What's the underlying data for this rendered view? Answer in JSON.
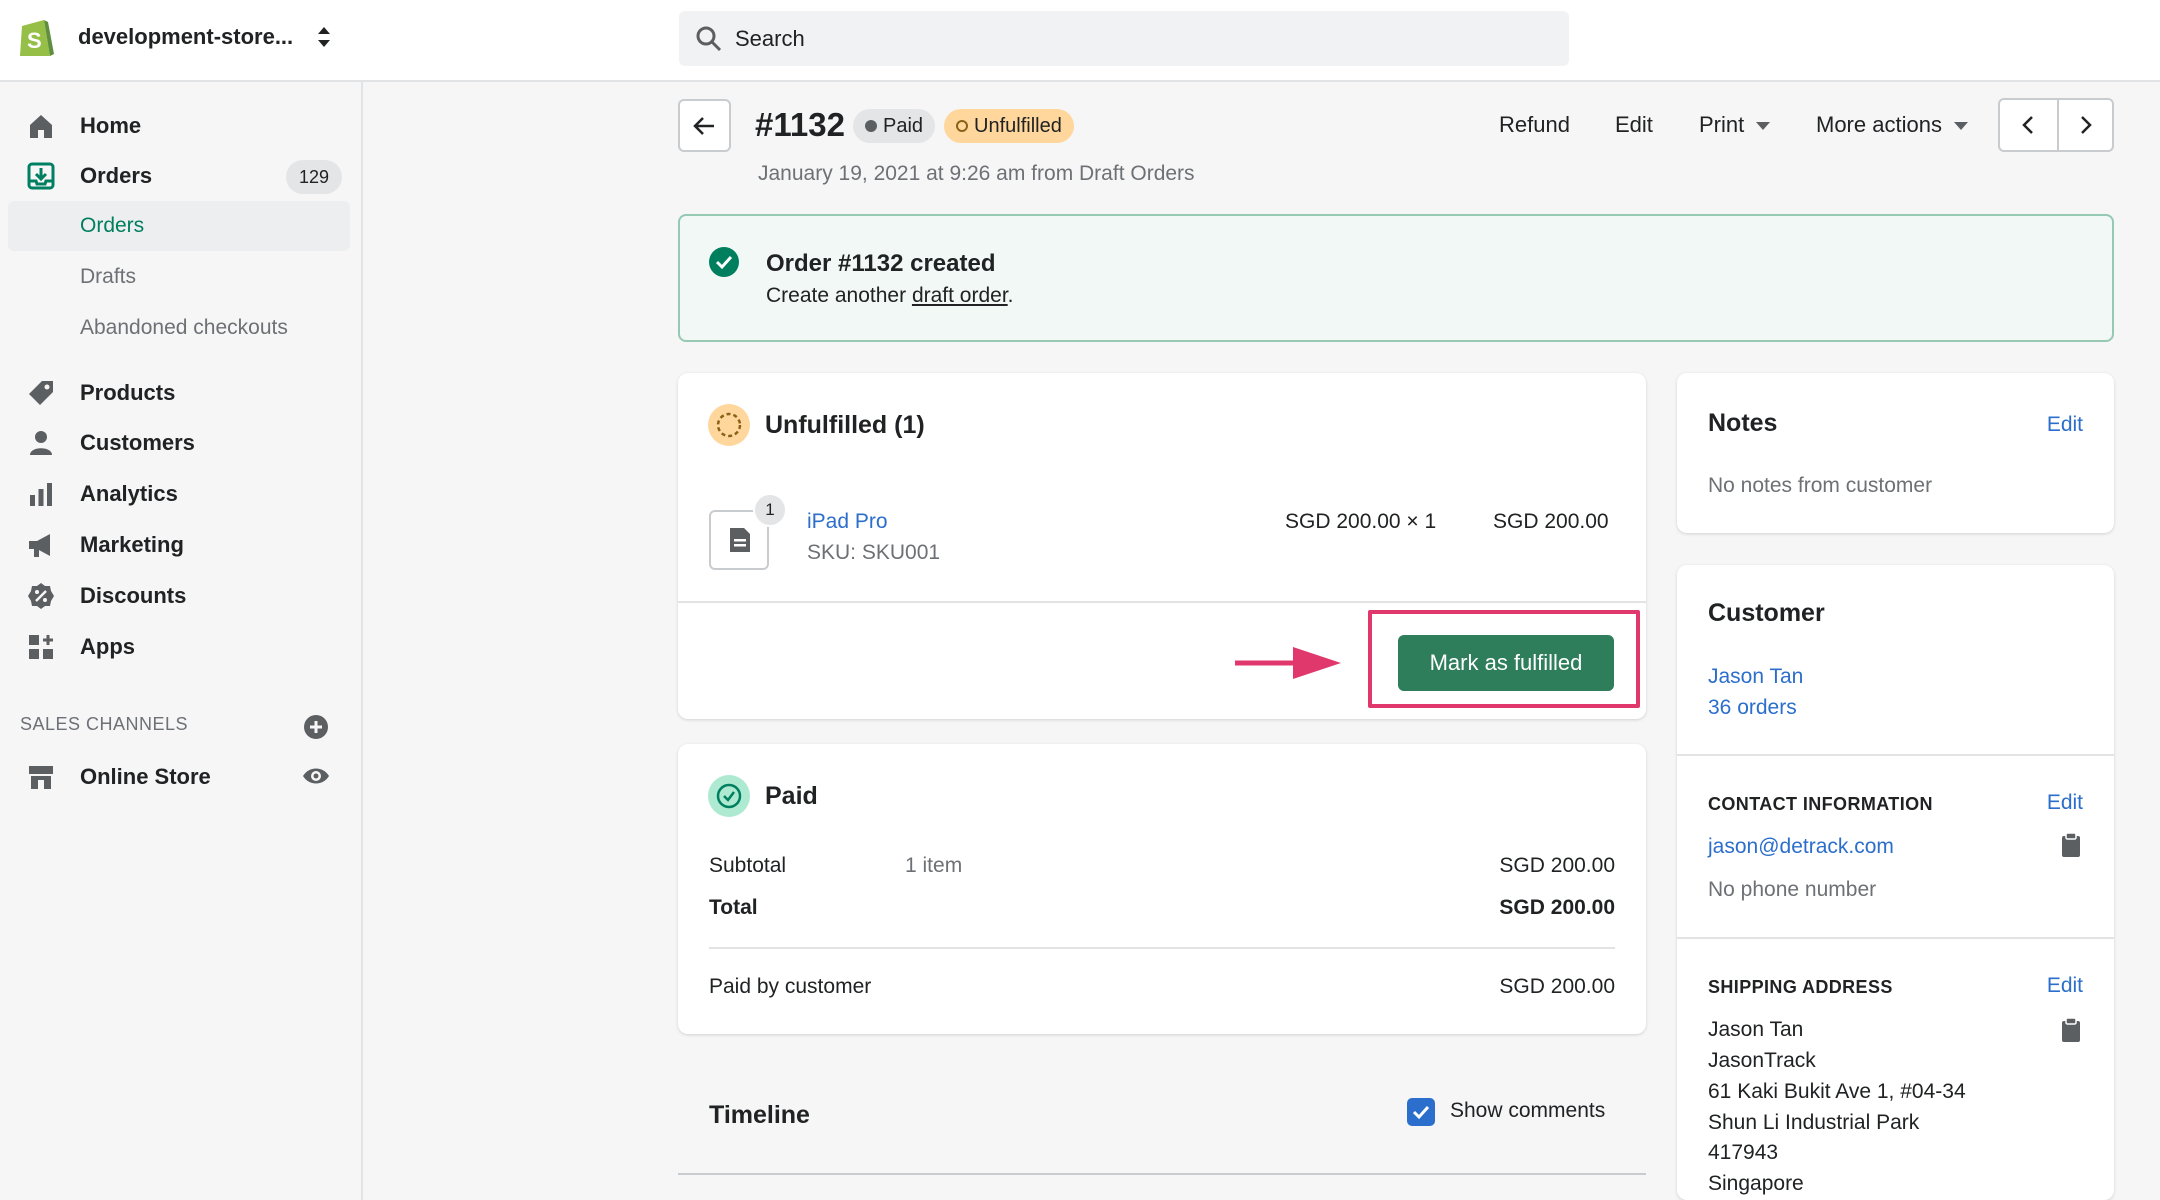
{
  "topbar": {
    "store_name": "development-store...",
    "search_placeholder": "Search"
  },
  "sidebar": {
    "items": [
      {
        "label": "Home",
        "icon": "home-icon"
      },
      {
        "label": "Orders",
        "icon": "orders-icon",
        "count": "129"
      },
      {
        "label": "Products",
        "icon": "tag-icon"
      },
      {
        "label": "Customers",
        "icon": "person-icon"
      },
      {
        "label": "Analytics",
        "icon": "bar-chart-icon"
      },
      {
        "label": "Marketing",
        "icon": "megaphone-icon"
      },
      {
        "label": "Discounts",
        "icon": "discount-icon"
      },
      {
        "label": "Apps",
        "icon": "apps-icon"
      }
    ],
    "orders_sub": [
      "Orders",
      "Drafts",
      "Abandoned checkouts"
    ],
    "sales_channels_title": "SALES CHANNELS",
    "online_store": "Online Store"
  },
  "order": {
    "title": "#1132",
    "paid_badge": "Paid",
    "unfulfilled_badge": "Unfulfilled",
    "subtitle": "January 19, 2021 at 9:26 am from Draft Orders",
    "actions": {
      "refund": "Refund",
      "edit": "Edit",
      "print": "Print",
      "more": "More actions"
    }
  },
  "banner": {
    "title": "Order #1132 created",
    "text_before": "Create another ",
    "link": "draft order",
    "text_after": "."
  },
  "unfulfilled_card": {
    "title": "Unfulfilled (1)",
    "item_name": "iPad Pro",
    "sku": "SKU: SKU001",
    "quantity": "1",
    "unit_price": "SGD 200.00 × 1",
    "line_total": "SGD 200.00",
    "button": "Mark as fulfilled"
  },
  "paid_card": {
    "title": "Paid",
    "subtotal_label": "Subtotal",
    "subtotal_items": "1 item",
    "subtotal_value": "SGD 200.00",
    "total_label": "Total",
    "total_value": "SGD 200.00",
    "paid_by_label": "Paid by customer",
    "paid_by_value": "SGD 200.00"
  },
  "timeline": {
    "title": "Timeline",
    "show_comments": "Show comments"
  },
  "notes": {
    "title": "Notes",
    "edit": "Edit",
    "text": "No notes from customer"
  },
  "customer": {
    "title": "Customer",
    "name": "Jason Tan",
    "orders": "36 orders",
    "contact_title": "CONTACT INFORMATION",
    "contact_edit": "Edit",
    "email": "jason@detrack.com",
    "phone": "No phone number",
    "shipping_title": "SHIPPING ADDRESS",
    "shipping_edit": "Edit",
    "address": [
      "Jason Tan",
      "JasonTrack",
      "61 Kaki Bukit Ave 1, #04-34",
      "Shun Li Industrial Park",
      "417943",
      "Singapore"
    ]
  },
  "colors": {
    "accent_green": "#2e7d5b",
    "link_blue": "#2c6ecb",
    "highlight_pink": "#e0386d",
    "unfulfilled_yellow": "#ffd79d"
  }
}
